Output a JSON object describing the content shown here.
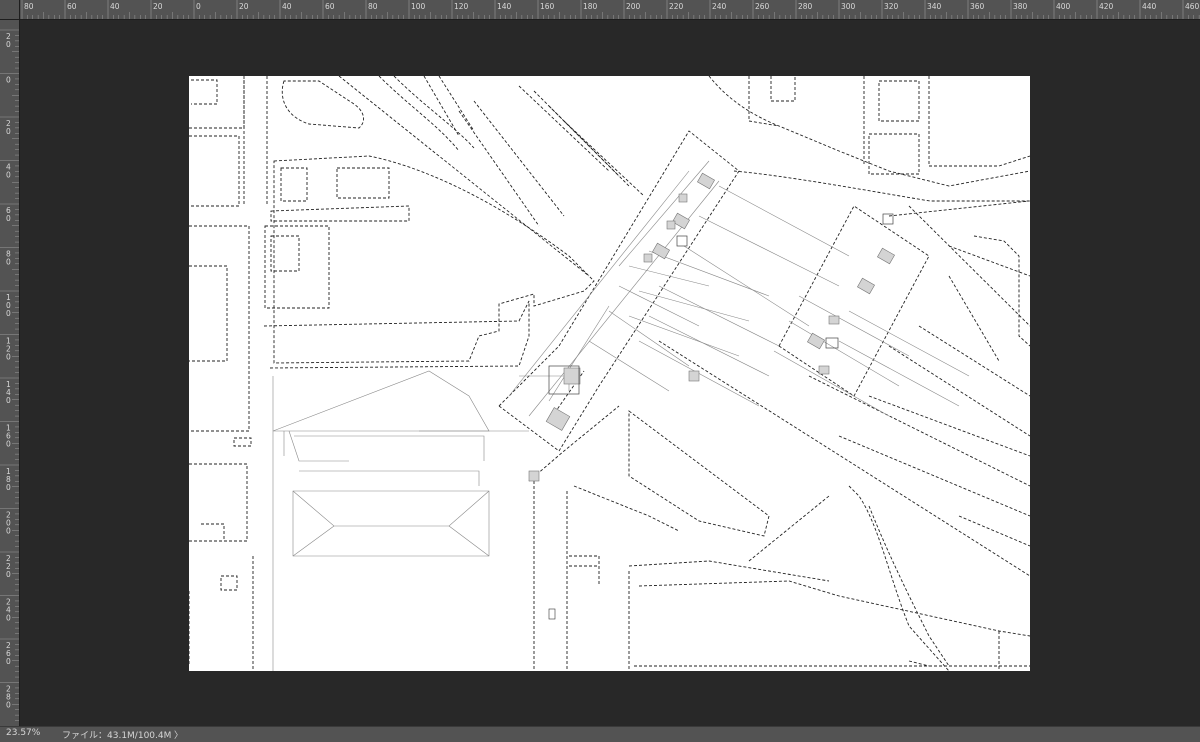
{
  "ruler_top_labels": [
    "80",
    "60",
    "40",
    "20",
    "0",
    "20",
    "40",
    "60",
    "80",
    "100",
    "120",
    "140",
    "160",
    "180",
    "200",
    "220",
    "240",
    "260",
    "280",
    "300",
    "320",
    "340",
    "360",
    "380",
    "400",
    "420",
    "440",
    "460"
  ],
  "ruler_left_labels": [
    "20",
    "0",
    "20",
    "40",
    "60",
    "80",
    "100",
    "120",
    "140",
    "160",
    "180",
    "200",
    "220",
    "240",
    "260",
    "280"
  ],
  "status": {
    "zoom": "23.57%",
    "file_info": "ファイル：43.1M/100.4M",
    "arrow": "〉"
  },
  "colors": {
    "workspace": "#282828",
    "ruler": "#535353",
    "canvas": "#ffffff"
  }
}
